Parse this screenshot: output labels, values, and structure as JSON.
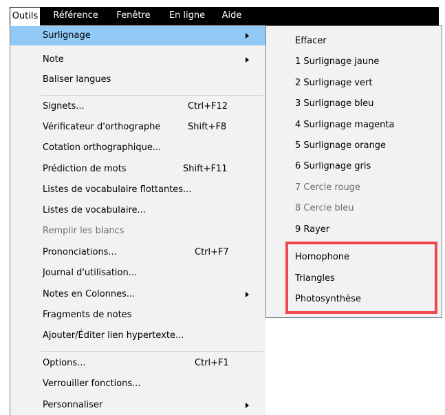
{
  "menubar": {
    "items": [
      {
        "label": "Outils"
      },
      {
        "label": "Référence"
      },
      {
        "label": "Fenêtre"
      },
      {
        "label": "En ligne"
      },
      {
        "label": "Aide"
      }
    ]
  },
  "menu": {
    "items": [
      {
        "label": "Surlignage",
        "shortcut": "",
        "submenu": true
      },
      {
        "label": "Note",
        "shortcut": "",
        "submenu": true
      },
      {
        "label": "Baliser langues",
        "shortcut": ""
      },
      {
        "label": "Signets...",
        "shortcut": "Ctrl+F12"
      },
      {
        "label": "Vérificateur d'orthographe",
        "shortcut": "Shift+F8"
      },
      {
        "label": "Cotation orthographique...",
        "shortcut": ""
      },
      {
        "label": "Prédiction de mots",
        "shortcut": "Shift+F11"
      },
      {
        "label": "Listes de vocabulaire flottantes...",
        "shortcut": ""
      },
      {
        "label": "Listes de vocabulaire...",
        "shortcut": ""
      },
      {
        "label": "Remplir les blancs",
        "shortcut": "",
        "disabled": true
      },
      {
        "label": "Prononciations...",
        "shortcut": "Ctrl+F7"
      },
      {
        "label": "Journal d'utilisation...",
        "shortcut": ""
      },
      {
        "label": "Notes en Colonnes...",
        "shortcut": "",
        "submenu": true
      },
      {
        "label": "Fragments de notes",
        "shortcut": ""
      },
      {
        "label": "Ajouter/Éditer lien hypertexte...",
        "shortcut": ""
      },
      {
        "label": "Options...",
        "shortcut": "Ctrl+F1"
      },
      {
        "label": "Verrouiller fonctions...",
        "shortcut": ""
      },
      {
        "label": "Personnaliser",
        "shortcut": "",
        "submenu": true
      }
    ]
  },
  "submenu": {
    "items": [
      {
        "label": "Effacer"
      },
      {
        "label": "1 Surlignage jaune"
      },
      {
        "label": "2 Surlignage vert"
      },
      {
        "label": "3 Surlignage bleu"
      },
      {
        "label": "4 Surlignage magenta"
      },
      {
        "label": "5 Surlignage orange"
      },
      {
        "label": "6 Surlignage gris"
      },
      {
        "label": "7 Cercle rouge",
        "disabled": true
      },
      {
        "label": "8 Cercle bleu",
        "disabled": true
      },
      {
        "label": "9 Rayer"
      },
      {
        "label": "Homophone"
      },
      {
        "label": "Triangles"
      },
      {
        "label": "Photosynthèse"
      }
    ]
  },
  "colors": {
    "menubar_bg": "#000000",
    "menu_bg": "#f2f2f2",
    "selected_bg": "#91c9f7",
    "highlight_border": "#f0474c",
    "disabled_text": "#6d6d6d"
  }
}
